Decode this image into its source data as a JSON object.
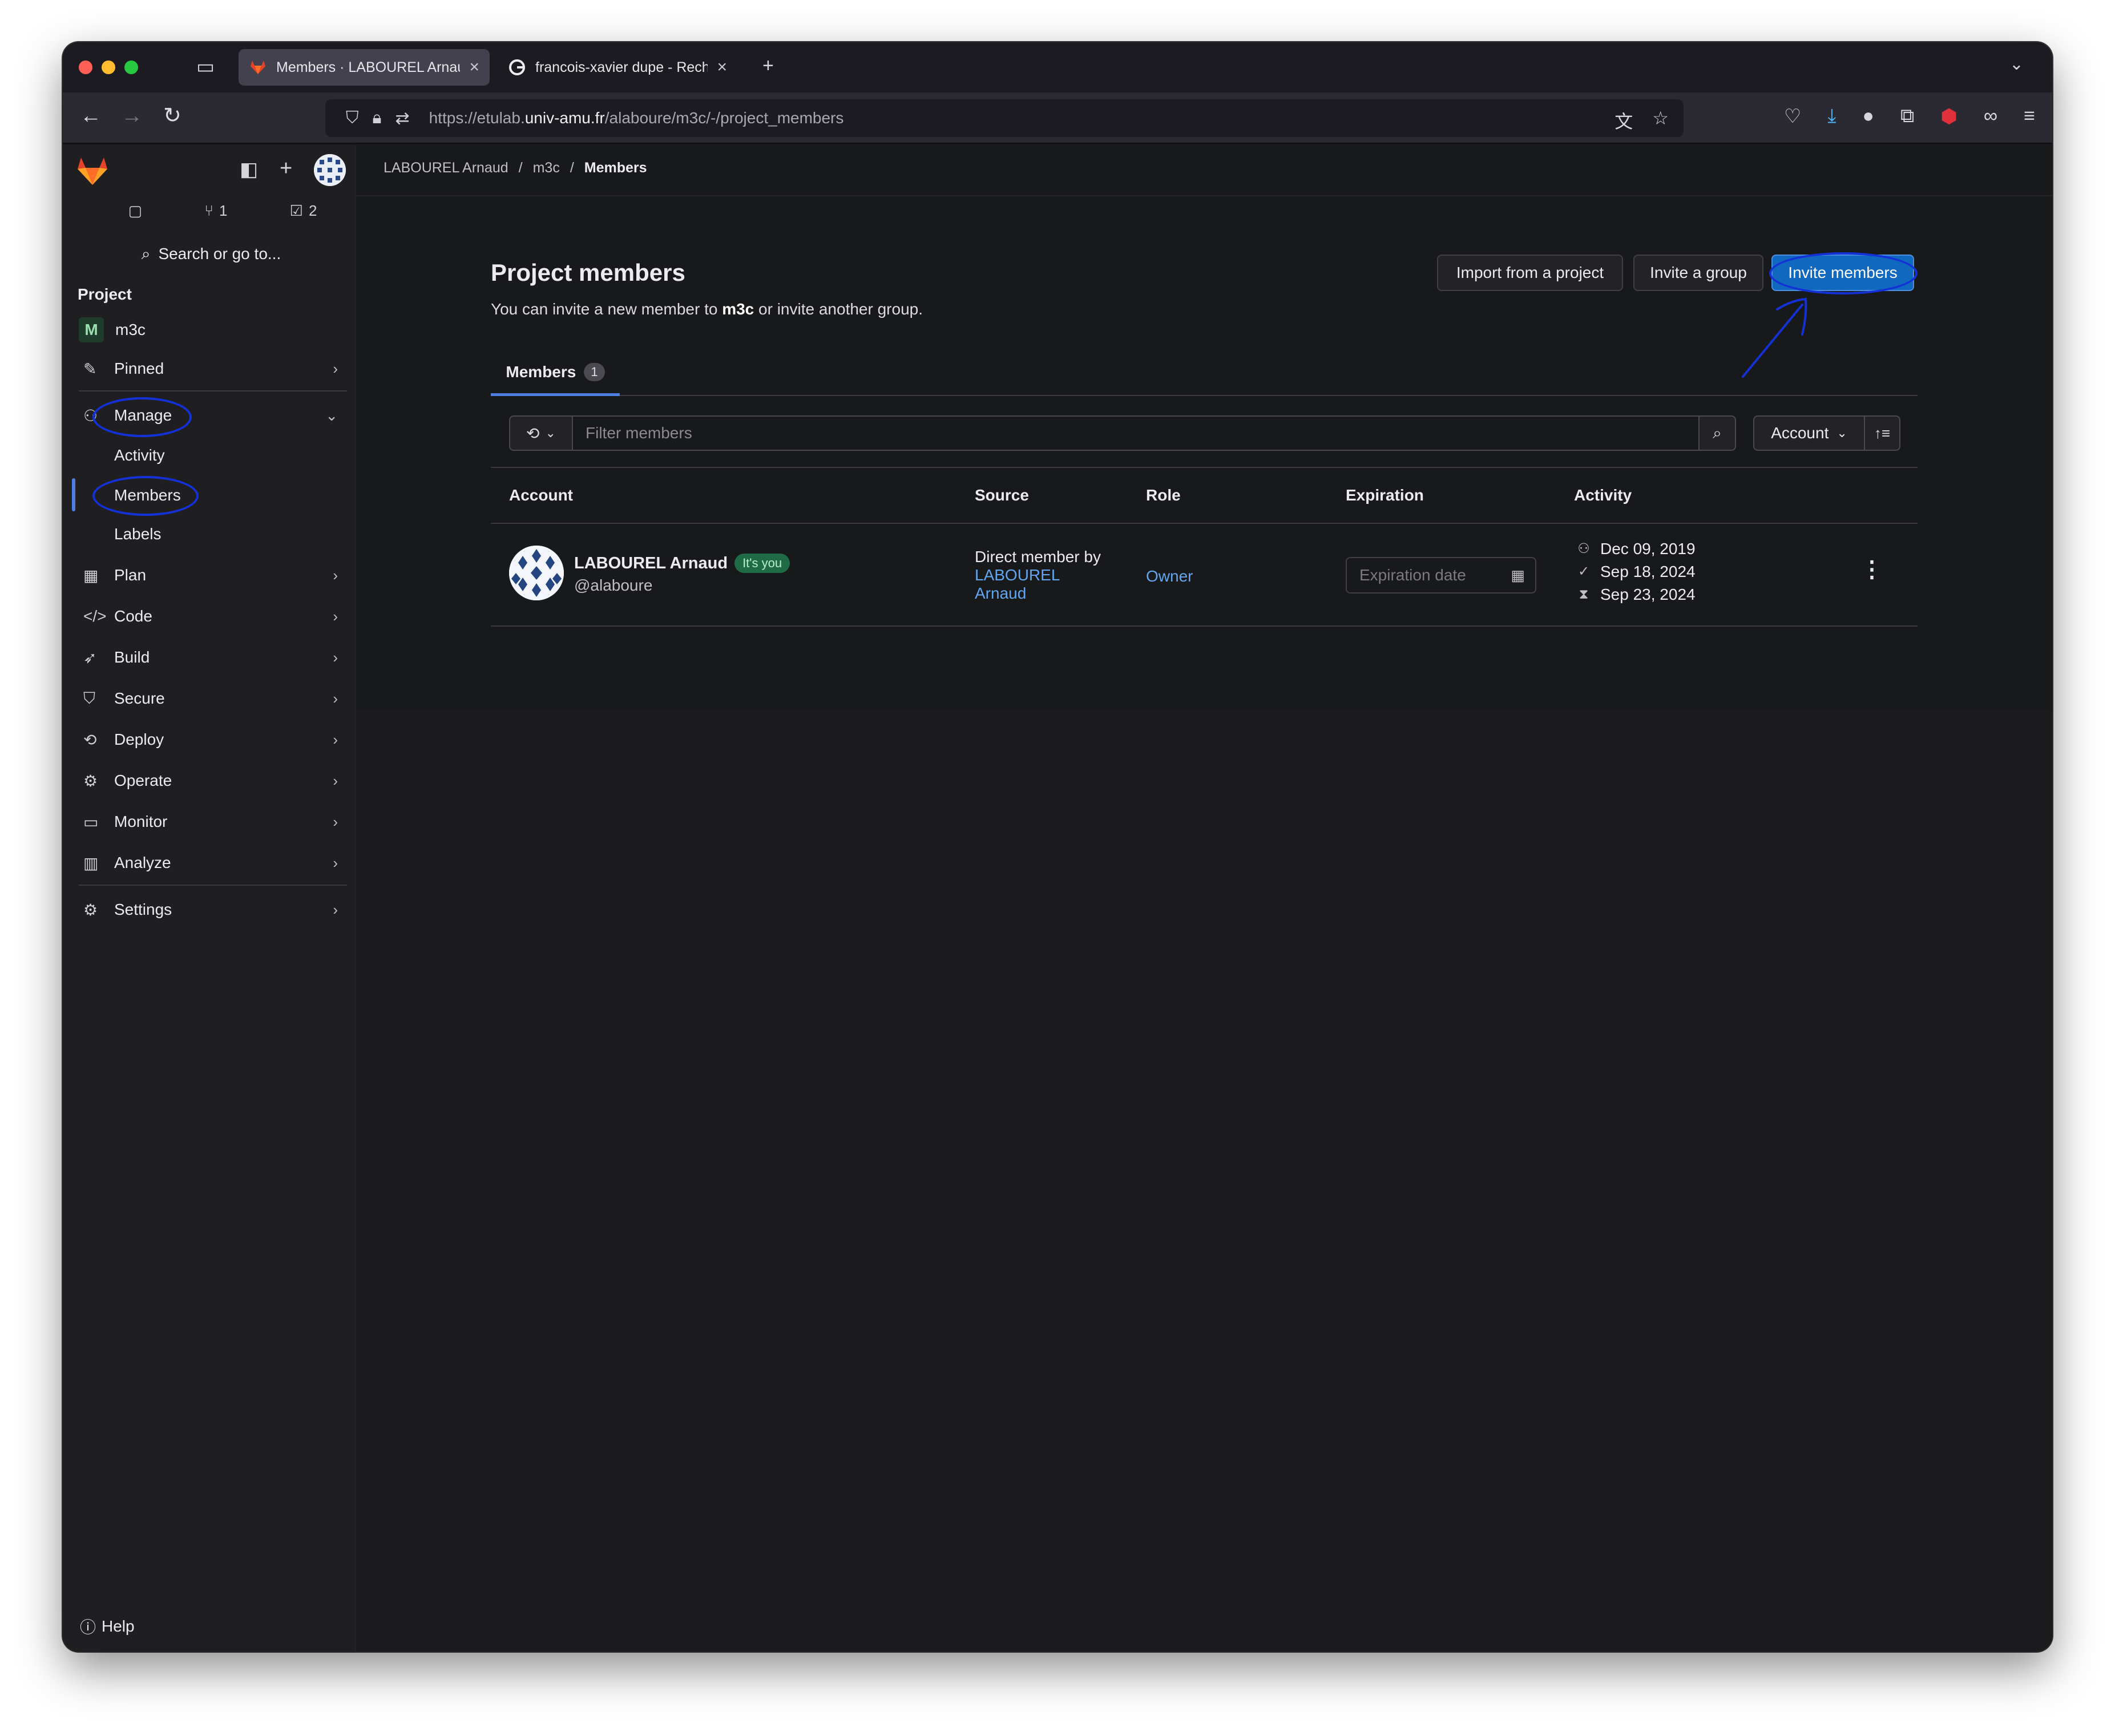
{
  "browser": {
    "tabs": [
      {
        "title": "Members · LABOUREL Arnaud / ",
        "active": true
      },
      {
        "title": "francois-xavier dupe - Recherch",
        "active": false
      }
    ],
    "url_prefix": "https://etulab.",
    "url_domain": "univ-amu.fr",
    "url_path": "/alaboure/m3c/-/project_members"
  },
  "sidebar": {
    "counts": {
      "merge_requests": "1",
      "todos": "2"
    },
    "search_label": "Search or go to...",
    "section_title": "Project",
    "project_badge": "M",
    "project_name": "m3c",
    "pinned": "Pinned",
    "manage": "Manage",
    "manage_items": [
      "Activity",
      "Members",
      "Labels"
    ],
    "groups": [
      "Plan",
      "Code",
      "Build",
      "Secure",
      "Deploy",
      "Operate",
      "Monitor",
      "Analyze"
    ],
    "settings": "Settings",
    "help": "Help"
  },
  "breadcrumb": [
    "LABOUREL Arnaud",
    "m3c",
    "Members"
  ],
  "page": {
    "title": "Project members",
    "desc_before": "You can invite a new member to ",
    "desc_project": "m3c",
    "desc_after": " or invite another group.",
    "buttons": {
      "import": "Import from a project",
      "invite_group": "Invite a group",
      "invite_members": "Invite members"
    }
  },
  "tabs": {
    "members_label": "Members",
    "members_count": "1"
  },
  "filter": {
    "placeholder": "Filter members",
    "sort_label": "Account"
  },
  "table": {
    "headers": [
      "Account",
      "Source",
      "Role",
      "Expiration",
      "Activity"
    ],
    "rows": [
      {
        "name": "LABOUREL Arnaud",
        "badge": "It's you",
        "username": "@alaboure",
        "source_prefix": "Direct member by",
        "source_link_1": "LABOUREL",
        "source_link_2": "Arnaud",
        "role": "Owner",
        "expiration_placeholder": "Expiration date",
        "activity": [
          "Dec 09, 2019",
          "Sep 18, 2024",
          "Sep 23, 2024"
        ]
      }
    ]
  },
  "colors": {
    "accent": "#1068bf",
    "annotation": "#1431d8",
    "link": "#63a6f0"
  }
}
